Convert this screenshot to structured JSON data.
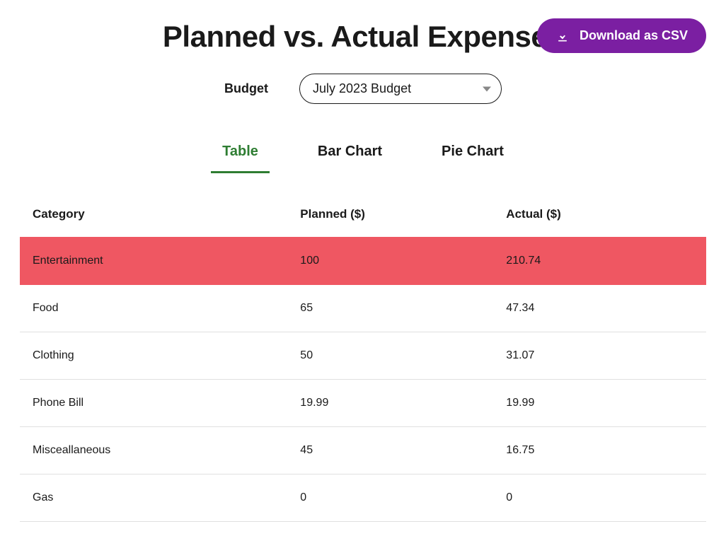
{
  "header": {
    "title": "Planned vs. Actual Expenses",
    "csv_label": "Download as CSV"
  },
  "budget": {
    "label": "Budget",
    "selected": "July 2023 Budget"
  },
  "tabs": {
    "table": "Table",
    "bar": "Bar Chart",
    "pie": "Pie Chart"
  },
  "table": {
    "columns": {
      "category": "Category",
      "planned": "Planned ($)",
      "actual": "Actual ($)"
    },
    "rows": [
      {
        "category": "Entertainment",
        "planned": "100",
        "actual": "210.74",
        "over": true
      },
      {
        "category": "Food",
        "planned": "65",
        "actual": "47.34",
        "over": false
      },
      {
        "category": "Clothing",
        "planned": "50",
        "actual": "31.07",
        "over": false
      },
      {
        "category": "Phone Bill",
        "planned": "19.99",
        "actual": "19.99",
        "over": false
      },
      {
        "category": "Misceallaneous",
        "planned": "45",
        "actual": "16.75",
        "over": false
      },
      {
        "category": "Gas",
        "planned": "0",
        "actual": "0",
        "over": false
      }
    ]
  },
  "colors": {
    "accent": "#7b1fa2",
    "active_tab": "#2e7d32",
    "over_row": "#ef5762"
  }
}
